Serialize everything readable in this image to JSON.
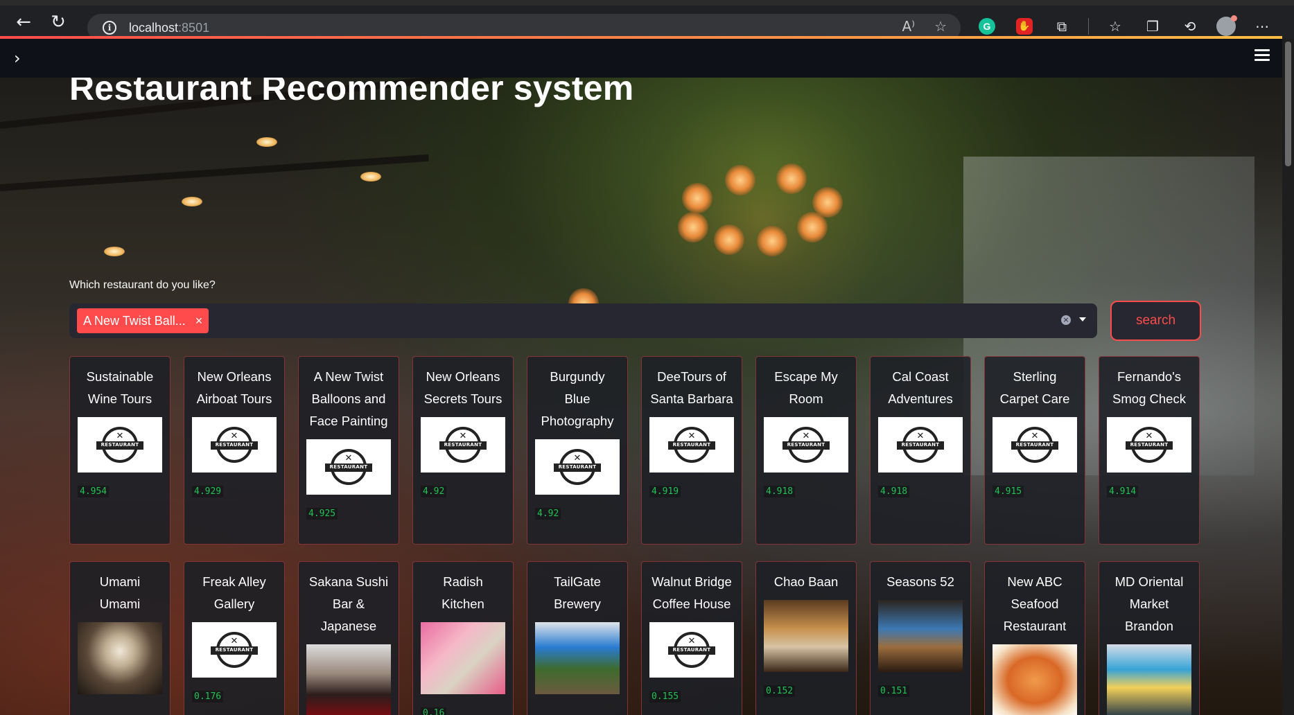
{
  "browser": {
    "url_host": "localhost",
    "url_port": ":8501"
  },
  "page": {
    "title": "Restaurant Recommender system"
  },
  "selector": {
    "label": "Which restaurant do you like?",
    "selected_chip": "A New Twist Ball...",
    "chip_remove": "×"
  },
  "search_button": {
    "label": "search"
  },
  "cards_row1": [
    {
      "name_lines": [
        "Sustainable",
        "Wine Tours"
      ],
      "score": "4.954",
      "image": "restaurant-logo"
    },
    {
      "name_lines": [
        "New Orleans",
        "Airboat Tours"
      ],
      "score": "4.929",
      "image": "restaurant-logo"
    },
    {
      "name_lines": [
        "A New Twist",
        "Balloons and",
        "Face Painting"
      ],
      "score": "4.925",
      "image": "restaurant-logo"
    },
    {
      "name_lines": [
        "New Orleans",
        "Secrets Tours"
      ],
      "score": "4.92",
      "image": "restaurant-logo"
    },
    {
      "name_lines": [
        "Burgundy",
        "Blue",
        "Photography"
      ],
      "score": "4.92",
      "image": "restaurant-logo"
    },
    {
      "name_lines": [
        "DeeTours of",
        "Santa Barbara"
      ],
      "score": "4.919",
      "image": "restaurant-logo"
    },
    {
      "name_lines": [
        "Escape My",
        "Room"
      ],
      "score": "4.918",
      "image": "restaurant-logo"
    },
    {
      "name_lines": [
        "Cal Coast",
        "Adventures"
      ],
      "score": "4.918",
      "image": "restaurant-logo"
    },
    {
      "name_lines": [
        "Sterling",
        "Carpet Care"
      ],
      "score": "4.915",
      "image": "restaurant-logo"
    },
    {
      "name_lines": [
        "Fernando's",
        "Smog Check"
      ],
      "score": "4.914",
      "image": "restaurant-logo"
    }
  ],
  "cards_row2": [
    {
      "name_lines": [
        "Umami",
        "Umami"
      ],
      "score": "",
      "image": "chandelier-photo"
    },
    {
      "name_lines": [
        "Freak Alley",
        "Gallery"
      ],
      "score": "0.176",
      "image": "restaurant-logo"
    },
    {
      "name_lines": [
        "Sakana Sushi",
        "Bar &",
        "Japanese"
      ],
      "score": "",
      "image": "sushi-bar-photo"
    },
    {
      "name_lines": [
        "Radish",
        "Kitchen"
      ],
      "score": "0.16",
      "image": "radish-kitchen-photo"
    },
    {
      "name_lines": [
        "TailGate",
        "Brewery"
      ],
      "score": "",
      "image": "brewery-patio-photo"
    },
    {
      "name_lines": [
        "Walnut Bridge",
        "Coffee House"
      ],
      "score": "0.155",
      "image": "restaurant-logo"
    },
    {
      "name_lines": [
        "Chao Baan"
      ],
      "score": "0.152",
      "image": "chao-baan-photo"
    },
    {
      "name_lines": [
        "Seasons 52"
      ],
      "score": "0.151",
      "image": "seasons-52-photo"
    },
    {
      "name_lines": [
        "New ABC",
        "Seafood",
        "Restaurant"
      ],
      "score": "",
      "image": "seafood-dish-photo"
    },
    {
      "name_lines": [
        "MD Oriental",
        "Market",
        "Brandon"
      ],
      "score": "",
      "image": "market-photo"
    }
  ],
  "logo_text": "RESTAURANT",
  "colors": {
    "accent": "#ff4b4b",
    "score_green": "#21c354",
    "input_bg": "#262730"
  }
}
